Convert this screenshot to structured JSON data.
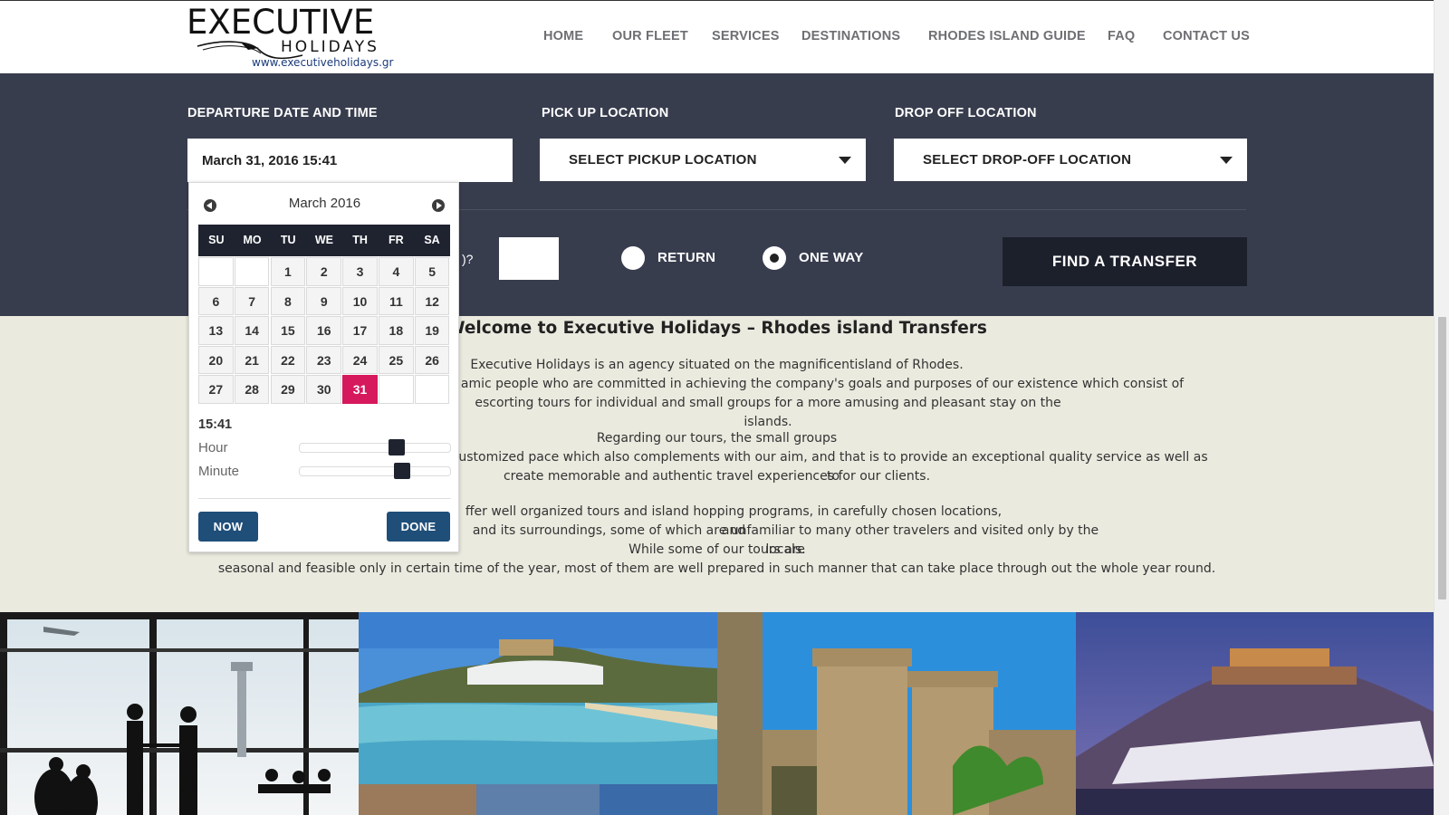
{
  "header": {
    "logo": {
      "name_big": "EXECUTIVE",
      "name_small": "HOLIDAYS",
      "url": "www.executiveholidays.gr"
    },
    "nav": [
      "HOME",
      "OUR FLEET",
      "SERVICES",
      "DESTINATIONS",
      "RHODES ISLAND GUIDE",
      "FAQ",
      "CONTACT US"
    ]
  },
  "booking": {
    "departure_label": "DEPARTURE DATE AND TIME",
    "departure_value": "March 31, 2016 15:41",
    "pickup_label": "PICK UP LOCATION",
    "pickup_placeholder": "SELECT PICKUP LOCATION",
    "dropoff_label": "DROP OFF LOCATION",
    "dropoff_placeholder": "SELECT DROP-OFF LOCATION",
    "passengers_fragment": ")?",
    "passengers_value": "",
    "return_label": "RETURN",
    "oneway_label": "ONE WAY",
    "trip_type_selected": "ONE WAY",
    "find_button": "FIND A TRANSFER"
  },
  "datepicker": {
    "month_title": "March 2016",
    "weekdays": [
      "SU",
      "MO",
      "TU",
      "WE",
      "TH",
      "FR",
      "SA"
    ],
    "weeks": [
      [
        "",
        "",
        "1",
        "2",
        "3",
        "4",
        "5"
      ],
      [
        "6",
        "7",
        "8",
        "9",
        "10",
        "11",
        "12"
      ],
      [
        "13",
        "14",
        "15",
        "16",
        "17",
        "18",
        "19"
      ],
      [
        "20",
        "21",
        "22",
        "23",
        "24",
        "25",
        "26"
      ],
      [
        "27",
        "28",
        "29",
        "30",
        "31",
        "",
        ""
      ]
    ],
    "selected_day": "31",
    "time": "15:41",
    "hour_label": "Hour",
    "hour_value": 15,
    "minute_label": "Minute",
    "minute_value": 41,
    "now_button": "NOW",
    "done_button": "DONE"
  },
  "welcome": {
    "title": "Welcome to Executive Holidays – Rhodes island Transfers",
    "lines": [
      "Executive Holidays is an agency situated on the magnificentisland of Rhodes.",
      "amic people who are committed in achieving the company's goals and purposes of our existence which consist of",
      "escorting tours for individual and small groups for a more amusing and pleasant stay on the islands.",
      "Regarding our tours, the small groups",
      "ustomized pace which also complements with our aim, and that is to provide an exceptional quality service as well as to",
      "create memorable and authentic travel experiences for our clients.",
      "ffer well organized tours and island hopping programs, in carefully chosen locations, and",
      "and its surroundings, some of which are unfamiliar to many other travelers and visited only by the locals.",
      "While some of our tours are",
      "seasonal and feasible only in certain time of the year, most of them are well prepared in such manner that can take place through out the whole year round."
    ]
  },
  "photos": [
    "airport-business-travelers",
    "lindos-beach-bay",
    "rhodes-medieval-castle",
    "lindos-acropolis-night"
  ],
  "colors": {
    "band": "#383d4e",
    "dark_button": "#1c202b",
    "selected_day": "#d6185c",
    "picker_button": "#1f4e79",
    "welcome_bg": "#ebeadf"
  }
}
